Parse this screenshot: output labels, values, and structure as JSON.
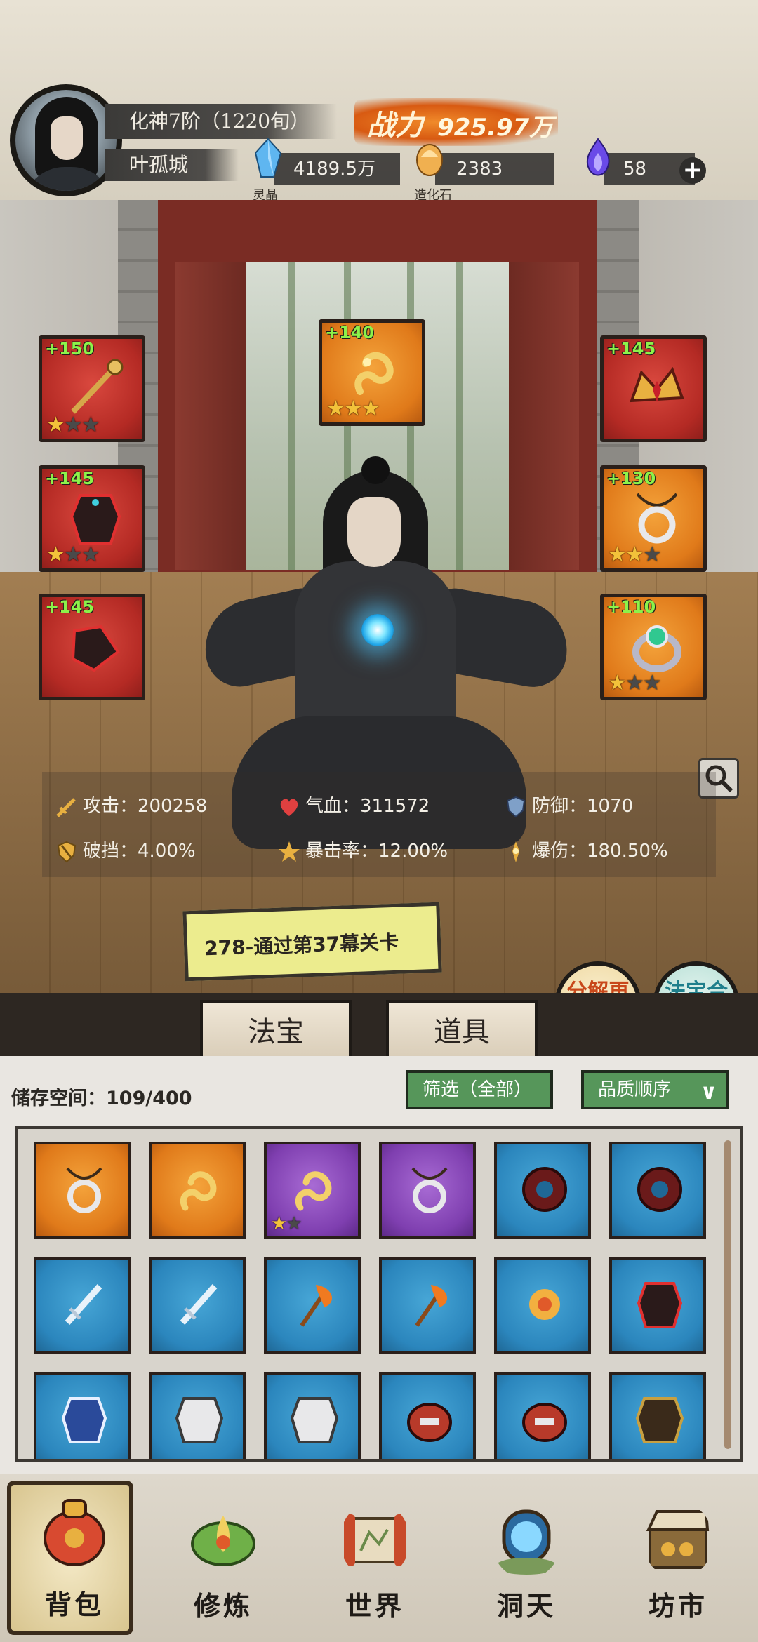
{
  "player": {
    "realm": "化神7阶（1220旬）",
    "name": "叶孤城",
    "power_label": "战力",
    "power_value": "925.97万"
  },
  "resources": [
    {
      "caption": "灵晶",
      "value": "4189.5万",
      "icon": "blue-crystal-icon",
      "color": "#4aa3e8"
    },
    {
      "caption": "造化石",
      "value": "2383",
      "icon": "amber-stone-icon",
      "color": "#e8a04a"
    },
    {
      "caption": "",
      "value": "58",
      "icon": "purple-flame-icon",
      "color": "#6a4ae8"
    }
  ],
  "equipment": [
    {
      "slot": "weapon",
      "bonus": "+150",
      "stars": 1,
      "max_stars": 3,
      "rarity": "red",
      "icon": "staff-icon"
    },
    {
      "slot": "artifact",
      "bonus": "+140",
      "stars": 3,
      "max_stars": 3,
      "rarity": "orange",
      "icon": "gold-dragon-icon"
    },
    {
      "slot": "headgear",
      "bonus": "+145",
      "stars": 0,
      "max_stars": 0,
      "rarity": "red",
      "icon": "crown-icon"
    },
    {
      "slot": "armor",
      "bonus": "+145",
      "stars": 1,
      "max_stars": 3,
      "rarity": "red",
      "icon": "robe-icon"
    },
    {
      "slot": "necklace",
      "bonus": "+130",
      "stars": 2,
      "max_stars": 3,
      "rarity": "orange",
      "icon": "pendant-icon"
    },
    {
      "slot": "boots",
      "bonus": "+145",
      "stars": 0,
      "max_stars": 0,
      "rarity": "red",
      "icon": "boots-icon"
    },
    {
      "slot": "ring",
      "bonus": "+110",
      "stars": 1,
      "max_stars": 3,
      "rarity": "orange",
      "icon": "jade-ring-icon"
    }
  ],
  "stats": [
    {
      "label": "攻击：200258",
      "icon": "sword-icon"
    },
    {
      "label": "气血：311572",
      "icon": "heart-icon"
    },
    {
      "label": "防御：1070",
      "icon": "shield-icon"
    },
    {
      "label": "破挡：4.00%",
      "icon": "break-shield-icon"
    },
    {
      "label": "暴击率：12.00%",
      "icon": "crit-icon"
    },
    {
      "label": "爆伤：180.50%",
      "icon": "crit-damage-icon"
    }
  ],
  "quest": {
    "text": "278-通过第37幕关卡"
  },
  "actions": {
    "decompose": "分解再造",
    "synthesize": "法宝合成"
  },
  "tabs": [
    "法宝",
    "道具"
  ],
  "inventory": {
    "storage": "储存空间：109/400",
    "filter": "筛选（全部）",
    "sort": "品质顺序",
    "items": [
      {
        "rarity": "orange",
        "icon": "pendant-icon",
        "stars": 0
      },
      {
        "rarity": "orange",
        "icon": "gold-dragon-icon",
        "stars": 0
      },
      {
        "rarity": "purple",
        "icon": "gold-dragon-icon",
        "stars": 1
      },
      {
        "rarity": "purple",
        "icon": "pendant-icon",
        "stars": 0
      },
      {
        "rarity": "blue",
        "icon": "saw-blade-icon",
        "stars": 0
      },
      {
        "rarity": "blue",
        "icon": "saw-blade-icon",
        "stars": 0
      },
      {
        "rarity": "blue",
        "icon": "ice-sword-icon",
        "stars": 0
      },
      {
        "rarity": "blue",
        "icon": "ice-sword-icon",
        "stars": 0
      },
      {
        "rarity": "blue",
        "icon": "fire-axe-icon",
        "stars": 0
      },
      {
        "rarity": "blue",
        "icon": "fire-axe-icon",
        "stars": 0
      },
      {
        "rarity": "blue",
        "icon": "flower-bracer-icon",
        "stars": 0
      },
      {
        "rarity": "blue",
        "icon": "robe-icon",
        "stars": 0
      },
      {
        "rarity": "blue",
        "icon": "blue-robe-icon",
        "stars": 0
      },
      {
        "rarity": "blue",
        "icon": "white-armor-icon",
        "stars": 0
      },
      {
        "rarity": "blue",
        "icon": "white-armor-icon",
        "stars": 0
      },
      {
        "rarity": "blue",
        "icon": "red-helmet-icon",
        "stars": 0
      },
      {
        "rarity": "blue",
        "icon": "red-helmet-icon",
        "stars": 0
      },
      {
        "rarity": "blue",
        "icon": "dark-armor-icon",
        "stars": 0
      }
    ]
  },
  "nav": [
    {
      "label": "背包",
      "icon": "bag-icon",
      "active": true
    },
    {
      "label": "修炼",
      "icon": "lotus-icon",
      "active": false
    },
    {
      "label": "世界",
      "icon": "scroll-map-icon",
      "active": false
    },
    {
      "label": "洞天",
      "icon": "portal-icon",
      "active": false
    },
    {
      "label": "坊市",
      "icon": "market-icon",
      "active": false
    }
  ]
}
